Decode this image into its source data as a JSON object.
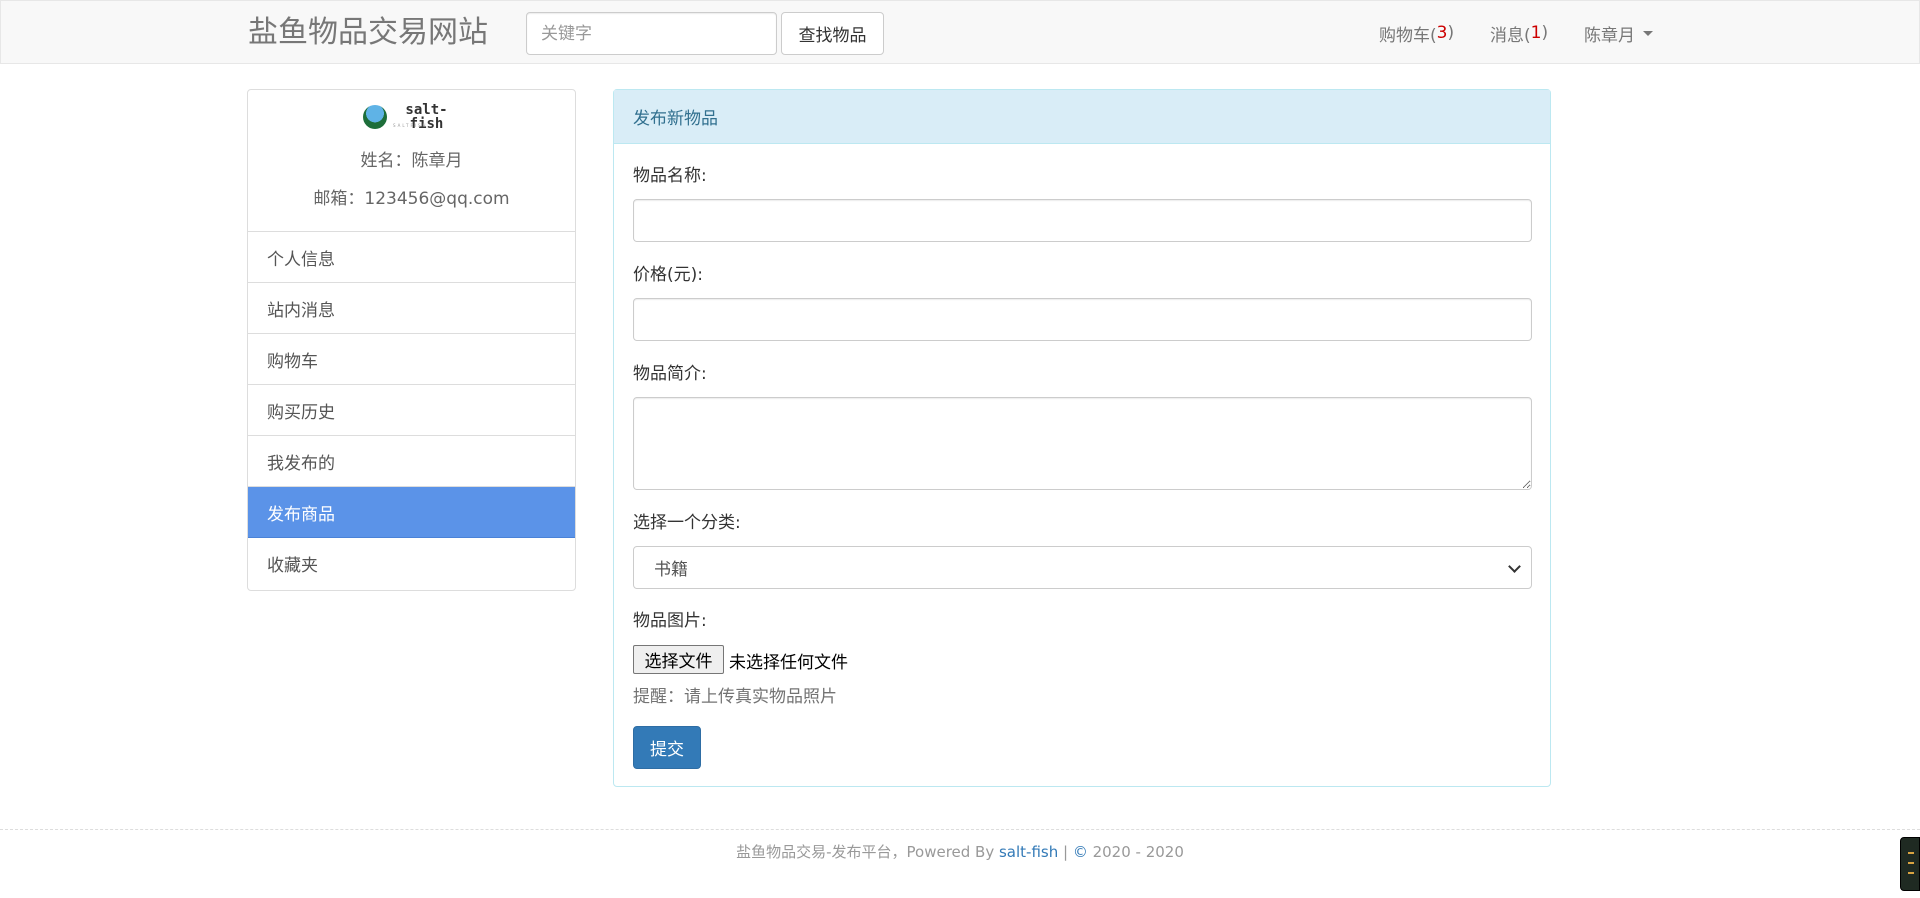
{
  "navbar": {
    "brand": "盐鱼物品交易网站",
    "search_placeholder": "关键字",
    "search_button": "查找物品",
    "cart_label": "购物车(",
    "cart_count": "3",
    "cart_close": ")",
    "messages_label": "消息(",
    "messages_count": "1",
    "messages_close": ")",
    "user_name": "陈章月"
  },
  "sidebar": {
    "logo_text": "salt-fish",
    "logo_subtext": "SALTFISH",
    "name_line": "姓名：陈章月",
    "email_line": "邮箱：123456@qq.com",
    "items": [
      {
        "label": "个人信息"
      },
      {
        "label": "站内消息"
      },
      {
        "label": "购物车"
      },
      {
        "label": "购买历史"
      },
      {
        "label": "我发布的"
      },
      {
        "label": "发布商品",
        "active": true
      },
      {
        "label": "收藏夹"
      }
    ]
  },
  "form": {
    "heading": "发布新物品",
    "name_label": "物品名称:",
    "name_value": "",
    "price_label": "价格(元):",
    "price_value": "",
    "desc_label": "物品简介:",
    "desc_value": "",
    "category_label": "选择一个分类:",
    "category_selected": "书籍",
    "image_label": "物品图片:",
    "file_button": "选择文件",
    "file_status": "未选择任何文件",
    "hint": "提醒：请上传真实物品照片",
    "submit": "提交"
  },
  "footer": {
    "prefix": "盐鱼物品交易-发布平台，Powered By ",
    "link": "salt-fish",
    "separator": " | ",
    "copyright_symbol": "©",
    "years": " 2020 - 2020"
  },
  "colors": {
    "active_menu": "#5b93e8",
    "panel_heading_bg": "#d9edf7",
    "panel_heading_text": "#31708f",
    "primary_button": "#337ab7",
    "count_red": "#cc0000"
  }
}
